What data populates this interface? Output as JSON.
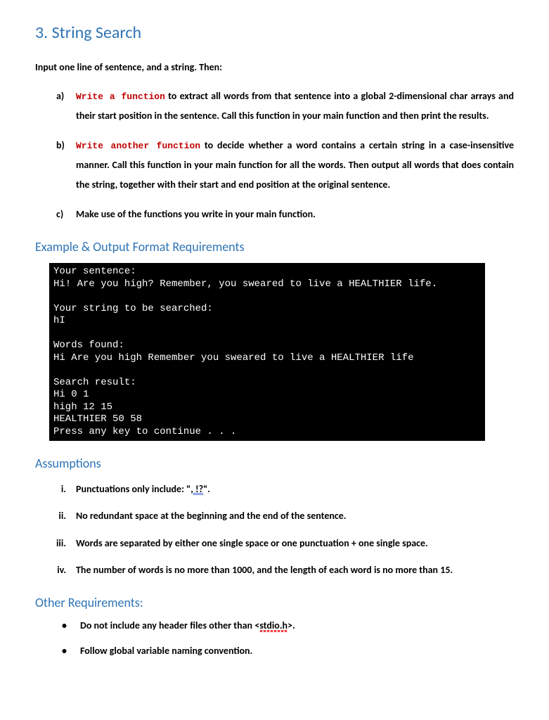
{
  "title": "3. String Search",
  "intro": "Input one line of sentence, and a string. Then:",
  "items": {
    "a": {
      "marker": "a)",
      "red": "Write a function",
      "rest": " to extract all words from that sentence into a global 2-dimensional char arrays and their start position in the sentence. Call this function in your main function and then print the results."
    },
    "b": {
      "marker": "b)",
      "red": "Write another function",
      "rest": " to decide whether a word contains a certain string in a case-insensitive manner. Call this function in your main function for all the words. Then output all words that does contain the string, together with their start and end position at the original sentence."
    },
    "c": {
      "marker": "c)",
      "text": "Make use of the functions you write in your main function."
    }
  },
  "example_heading": "Example & Output Format Requirements",
  "console_text": "Your sentence:\nHi! Are you high? Remember, you sweared to live a HEALTHIER life.\n\nYour string to be searched:\nhI\n\nWords found:\nHi Are you high Remember you sweared to live a HEALTHIER life\n\nSearch result:\nHi 0 1\nhigh 12 15\nHEALTHIER 50 58\nPress any key to continue . . .",
  "assumptions_heading": "Assumptions",
  "assumptions": {
    "i": {
      "marker": "i.",
      "pre": "Punctuations only include: \"",
      "squig": ", !?",
      "post": "\"."
    },
    "ii": {
      "marker": "ii.",
      "text": "No redundant space at the beginning and the end of the sentence."
    },
    "iii": {
      "marker": "iii.",
      "text": "Words are separated by either one single space or one punctuation + one single space."
    },
    "iv": {
      "marker": "iv.",
      "text": "The number of words is no more than 1000, and the length of each word is no more than 15."
    }
  },
  "other_heading": "Other Requirements:",
  "other": {
    "r1": {
      "pre": "Do not include any header files other than <",
      "squig": "stdio.h",
      "post": ">."
    },
    "r2": {
      "text": "Follow global variable naming convention."
    }
  }
}
